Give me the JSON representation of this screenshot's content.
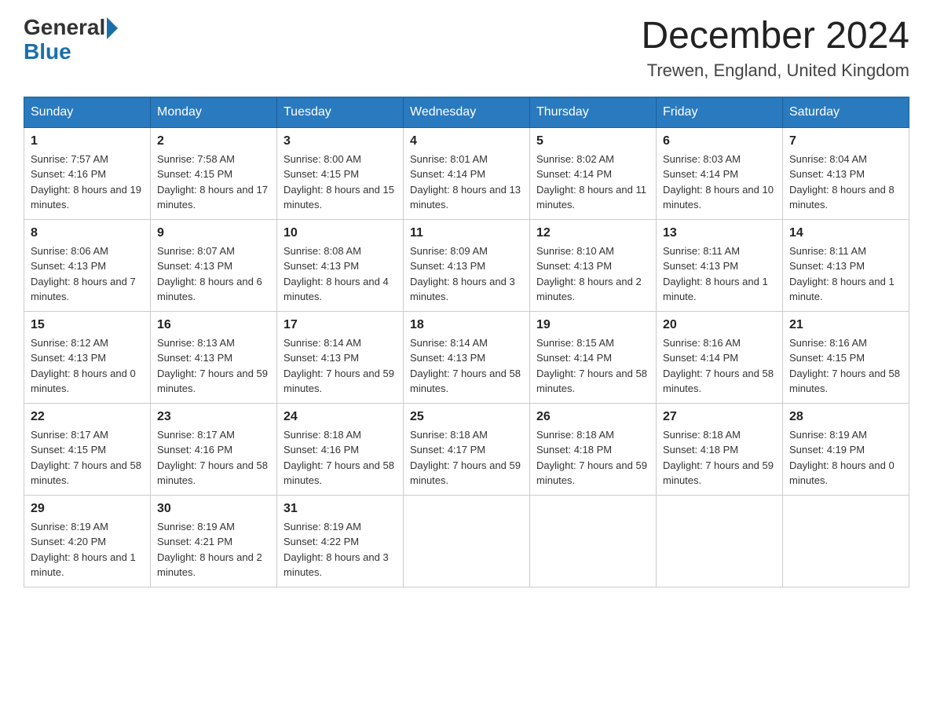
{
  "header": {
    "logo_general": "General",
    "logo_blue": "Blue",
    "main_title": "December 2024",
    "subtitle": "Trewen, England, United Kingdom"
  },
  "days_of_week": [
    "Sunday",
    "Monday",
    "Tuesday",
    "Wednesday",
    "Thursday",
    "Friday",
    "Saturday"
  ],
  "weeks": [
    [
      {
        "day": "1",
        "sunrise": "Sunrise: 7:57 AM",
        "sunset": "Sunset: 4:16 PM",
        "daylight": "Daylight: 8 hours and 19 minutes."
      },
      {
        "day": "2",
        "sunrise": "Sunrise: 7:58 AM",
        "sunset": "Sunset: 4:15 PM",
        "daylight": "Daylight: 8 hours and 17 minutes."
      },
      {
        "day": "3",
        "sunrise": "Sunrise: 8:00 AM",
        "sunset": "Sunset: 4:15 PM",
        "daylight": "Daylight: 8 hours and 15 minutes."
      },
      {
        "day": "4",
        "sunrise": "Sunrise: 8:01 AM",
        "sunset": "Sunset: 4:14 PM",
        "daylight": "Daylight: 8 hours and 13 minutes."
      },
      {
        "day": "5",
        "sunrise": "Sunrise: 8:02 AM",
        "sunset": "Sunset: 4:14 PM",
        "daylight": "Daylight: 8 hours and 11 minutes."
      },
      {
        "day": "6",
        "sunrise": "Sunrise: 8:03 AM",
        "sunset": "Sunset: 4:14 PM",
        "daylight": "Daylight: 8 hours and 10 minutes."
      },
      {
        "day": "7",
        "sunrise": "Sunrise: 8:04 AM",
        "sunset": "Sunset: 4:13 PM",
        "daylight": "Daylight: 8 hours and 8 minutes."
      }
    ],
    [
      {
        "day": "8",
        "sunrise": "Sunrise: 8:06 AM",
        "sunset": "Sunset: 4:13 PM",
        "daylight": "Daylight: 8 hours and 7 minutes."
      },
      {
        "day": "9",
        "sunrise": "Sunrise: 8:07 AM",
        "sunset": "Sunset: 4:13 PM",
        "daylight": "Daylight: 8 hours and 6 minutes."
      },
      {
        "day": "10",
        "sunrise": "Sunrise: 8:08 AM",
        "sunset": "Sunset: 4:13 PM",
        "daylight": "Daylight: 8 hours and 4 minutes."
      },
      {
        "day": "11",
        "sunrise": "Sunrise: 8:09 AM",
        "sunset": "Sunset: 4:13 PM",
        "daylight": "Daylight: 8 hours and 3 minutes."
      },
      {
        "day": "12",
        "sunrise": "Sunrise: 8:10 AM",
        "sunset": "Sunset: 4:13 PM",
        "daylight": "Daylight: 8 hours and 2 minutes."
      },
      {
        "day": "13",
        "sunrise": "Sunrise: 8:11 AM",
        "sunset": "Sunset: 4:13 PM",
        "daylight": "Daylight: 8 hours and 1 minute."
      },
      {
        "day": "14",
        "sunrise": "Sunrise: 8:11 AM",
        "sunset": "Sunset: 4:13 PM",
        "daylight": "Daylight: 8 hours and 1 minute."
      }
    ],
    [
      {
        "day": "15",
        "sunrise": "Sunrise: 8:12 AM",
        "sunset": "Sunset: 4:13 PM",
        "daylight": "Daylight: 8 hours and 0 minutes."
      },
      {
        "day": "16",
        "sunrise": "Sunrise: 8:13 AM",
        "sunset": "Sunset: 4:13 PM",
        "daylight": "Daylight: 7 hours and 59 minutes."
      },
      {
        "day": "17",
        "sunrise": "Sunrise: 8:14 AM",
        "sunset": "Sunset: 4:13 PM",
        "daylight": "Daylight: 7 hours and 59 minutes."
      },
      {
        "day": "18",
        "sunrise": "Sunrise: 8:14 AM",
        "sunset": "Sunset: 4:13 PM",
        "daylight": "Daylight: 7 hours and 58 minutes."
      },
      {
        "day": "19",
        "sunrise": "Sunrise: 8:15 AM",
        "sunset": "Sunset: 4:14 PM",
        "daylight": "Daylight: 7 hours and 58 minutes."
      },
      {
        "day": "20",
        "sunrise": "Sunrise: 8:16 AM",
        "sunset": "Sunset: 4:14 PM",
        "daylight": "Daylight: 7 hours and 58 minutes."
      },
      {
        "day": "21",
        "sunrise": "Sunrise: 8:16 AM",
        "sunset": "Sunset: 4:15 PM",
        "daylight": "Daylight: 7 hours and 58 minutes."
      }
    ],
    [
      {
        "day": "22",
        "sunrise": "Sunrise: 8:17 AM",
        "sunset": "Sunset: 4:15 PM",
        "daylight": "Daylight: 7 hours and 58 minutes."
      },
      {
        "day": "23",
        "sunrise": "Sunrise: 8:17 AM",
        "sunset": "Sunset: 4:16 PM",
        "daylight": "Daylight: 7 hours and 58 minutes."
      },
      {
        "day": "24",
        "sunrise": "Sunrise: 8:18 AM",
        "sunset": "Sunset: 4:16 PM",
        "daylight": "Daylight: 7 hours and 58 minutes."
      },
      {
        "day": "25",
        "sunrise": "Sunrise: 8:18 AM",
        "sunset": "Sunset: 4:17 PM",
        "daylight": "Daylight: 7 hours and 59 minutes."
      },
      {
        "day": "26",
        "sunrise": "Sunrise: 8:18 AM",
        "sunset": "Sunset: 4:18 PM",
        "daylight": "Daylight: 7 hours and 59 minutes."
      },
      {
        "day": "27",
        "sunrise": "Sunrise: 8:18 AM",
        "sunset": "Sunset: 4:18 PM",
        "daylight": "Daylight: 7 hours and 59 minutes."
      },
      {
        "day": "28",
        "sunrise": "Sunrise: 8:19 AM",
        "sunset": "Sunset: 4:19 PM",
        "daylight": "Daylight: 8 hours and 0 minutes."
      }
    ],
    [
      {
        "day": "29",
        "sunrise": "Sunrise: 8:19 AM",
        "sunset": "Sunset: 4:20 PM",
        "daylight": "Daylight: 8 hours and 1 minute."
      },
      {
        "day": "30",
        "sunrise": "Sunrise: 8:19 AM",
        "sunset": "Sunset: 4:21 PM",
        "daylight": "Daylight: 8 hours and 2 minutes."
      },
      {
        "day": "31",
        "sunrise": "Sunrise: 8:19 AM",
        "sunset": "Sunset: 4:22 PM",
        "daylight": "Daylight: 8 hours and 3 minutes."
      },
      null,
      null,
      null,
      null
    ]
  ]
}
